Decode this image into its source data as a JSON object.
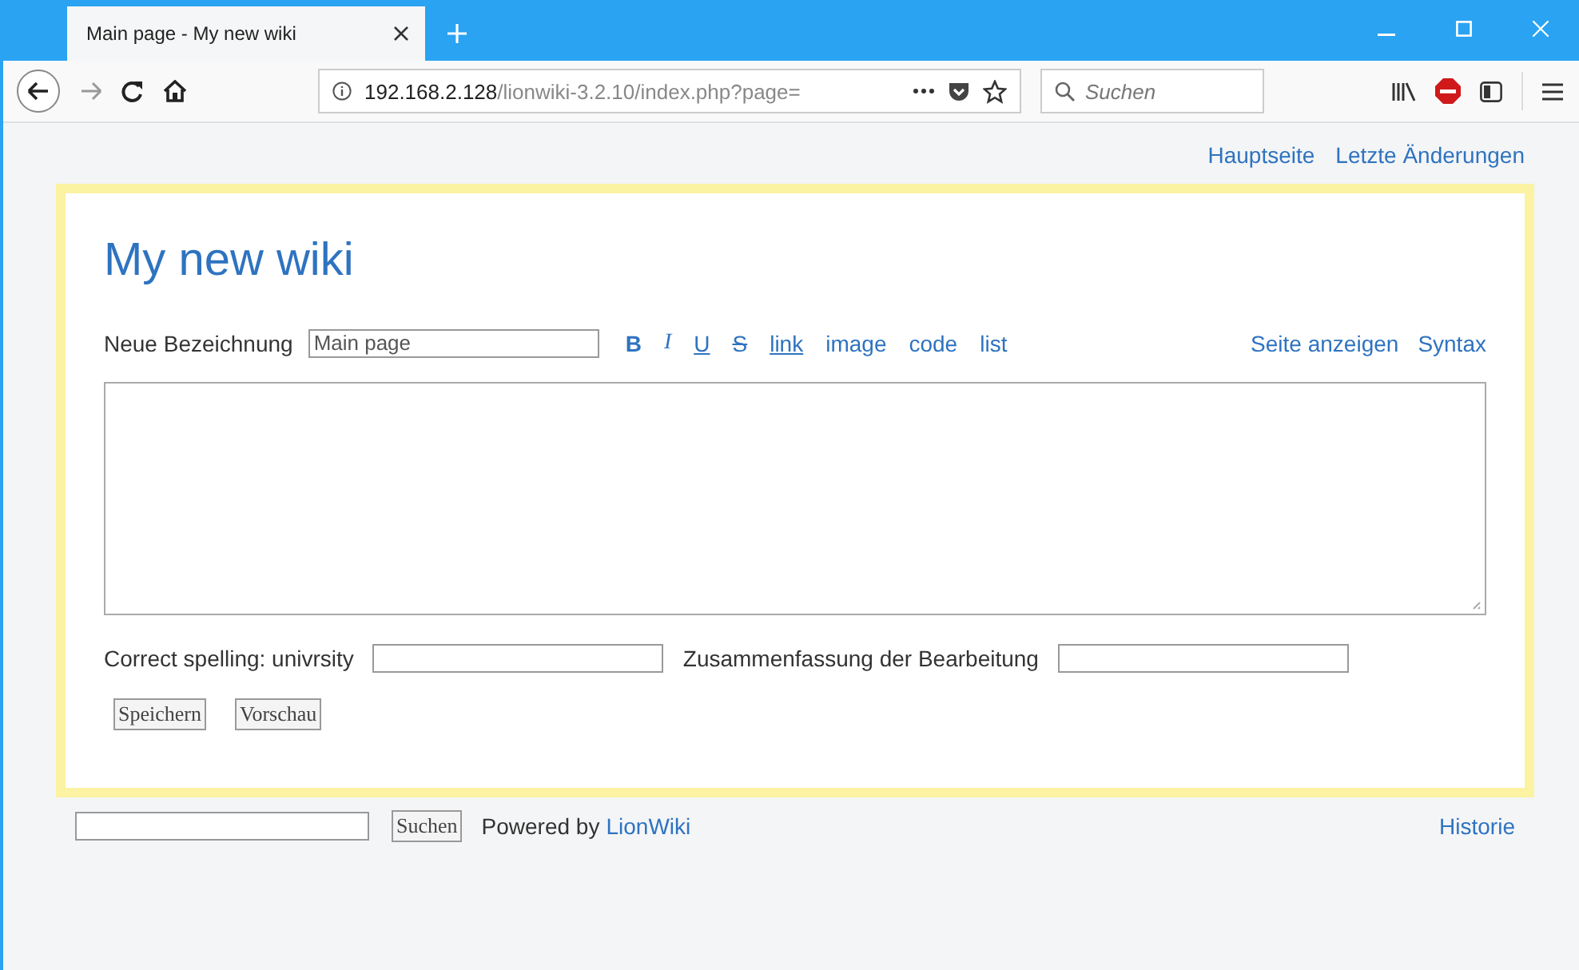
{
  "browser": {
    "tab_title": "Main page - My new wiki",
    "url_host": "192.168.2.128",
    "url_path": "/lionwiki-3.2.10/index.php?page=",
    "search_placeholder": "Suchen"
  },
  "top_links": [
    "Hauptseite",
    "Letzte Änderungen"
  ],
  "wiki_title": "My new wiki",
  "editor": {
    "name_label": "Neue Bezeichnung",
    "name_value": "Main page",
    "format_buttons": [
      {
        "label": "B",
        "kind": "bold"
      },
      {
        "label": "I",
        "kind": "italic"
      },
      {
        "label": "U",
        "kind": "underline"
      },
      {
        "label": "S",
        "kind": "strike"
      },
      {
        "label": "link",
        "kind": "link"
      },
      {
        "label": "image",
        "kind": "plain"
      },
      {
        "label": "code",
        "kind": "plain"
      },
      {
        "label": "list",
        "kind": "plain"
      }
    ],
    "right_links": [
      "Seite anzeigen",
      "Syntax"
    ],
    "spelling_label": "Correct spelling: univrsity",
    "summary_label": "Zusammenfassung der Bearbeitung",
    "buttons": [
      "Speichern",
      "Vorschau"
    ]
  },
  "footer": {
    "search_button": "Suchen",
    "powered_by": "Powered by",
    "powered_link": "LionWiki",
    "history_link": "Historie"
  }
}
